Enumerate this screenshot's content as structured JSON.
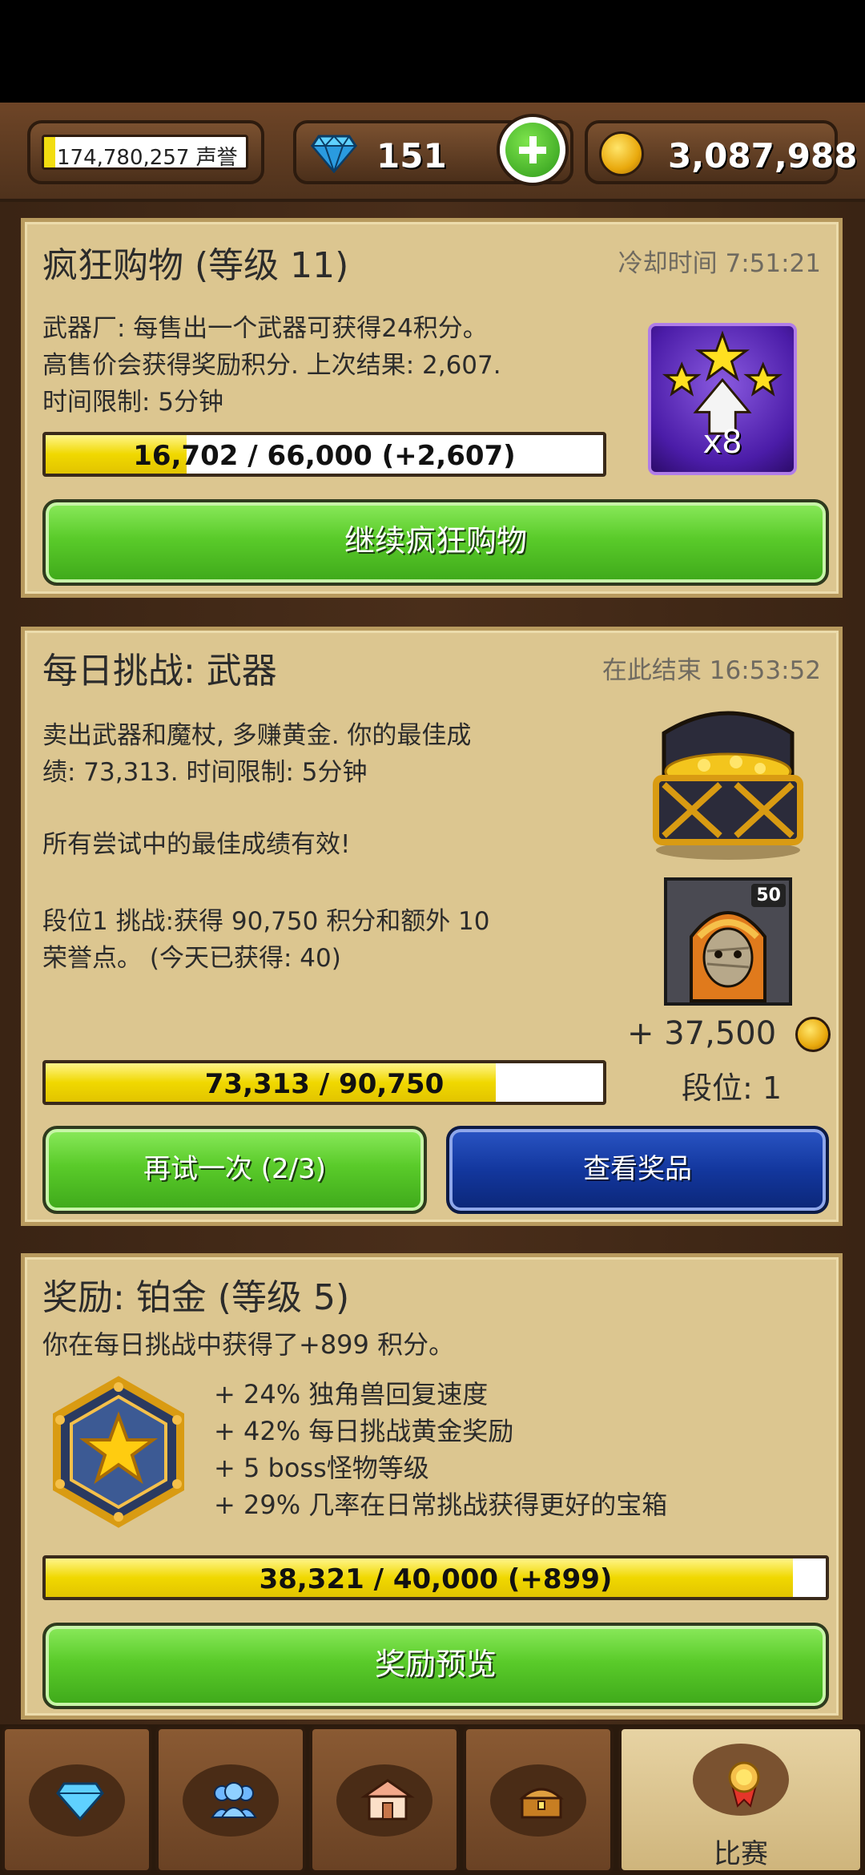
{
  "topbar": {
    "reputation": "174,780,257 声誉",
    "gems": "151",
    "gold": "3,087,988"
  },
  "frenzy": {
    "title": "疯狂购物 (等级 11)",
    "cooldown": "冷却时间 7:51:21",
    "desc": [
      "武器厂: 每售出一个武器可获得24积分。",
      "高售价会获得奖励积分. 上次结果: 2,607.",
      "时间限制: 5分钟"
    ],
    "multiplier": "x8",
    "progress_text": "16,702 / 66,000 (+2,607)",
    "progress": 0.253,
    "button": "继续疯狂购物"
  },
  "daily": {
    "title": "每日挑战: 武器",
    "ends": "在此结束 16:53:52",
    "desc1": [
      "卖出武器和魔杖, 多赚黄金. 你的最佳成",
      "绩: 73,313. 时间限制: 5分钟"
    ],
    "desc2": "所有尝试中的最佳成绩有效!",
    "desc3": [
      "段位1 挑战:获得 90,750 积分和额外 10",
      "荣誉点。 (今天已获得: 40)"
    ],
    "boss_level": "50",
    "reward_gold": "+ 37,500",
    "rank": "段位: 1",
    "progress_text": "73,313 / 90,750",
    "progress": 0.808,
    "retry_button": "再试一次 (2/3)",
    "prize_button": "查看奖品"
  },
  "reward": {
    "title": "奖励: 铂金 (等级 5)",
    "earned": "你在每日挑战中获得了+899 积分。",
    "perks": [
      "+ 24% 独角兽回复速度",
      "+ 42% 每日挑战黄金奖励",
      "+ 5 boss怪物等级",
      "+ 29% 几率在日常挑战获得更好的宝箱"
    ],
    "progress_text": "38,321 / 40,000 (+899)",
    "progress": 0.958,
    "button": "奖励预览"
  },
  "nav": {
    "tabs": [
      {
        "icon": "diamond-icon"
      },
      {
        "icon": "people-icon"
      },
      {
        "icon": "shop-icon"
      },
      {
        "icon": "chest-icon"
      },
      {
        "icon": "medal-icon",
        "label": "比赛",
        "active": true
      }
    ]
  }
}
